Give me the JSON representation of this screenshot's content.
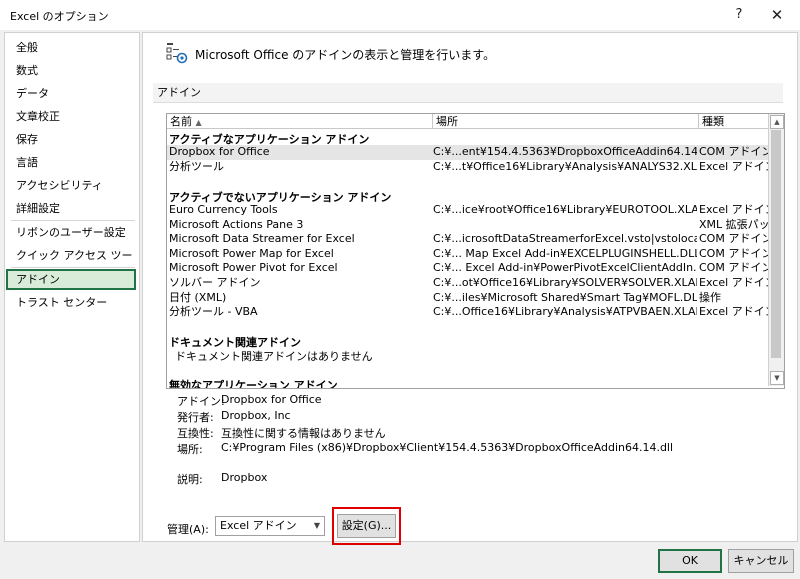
{
  "window": {
    "title": "Excel のオプション",
    "help": "?",
    "close": "✕"
  },
  "sidebar": {
    "items": [
      "全般",
      "数式",
      "データ",
      "文章校正",
      "保存",
      "言語",
      "アクセシビリティ",
      "詳細設定",
      "リボンのユーザー設定",
      "クイック アクセス ツール バー",
      "アドイン",
      "トラスト センター"
    ],
    "active": "アドイン"
  },
  "main": {
    "header": "Microsoft Office のアドインの表示と管理を行います。",
    "section": "アドイン",
    "columns": {
      "name": "名前",
      "sort": "▲",
      "location": "場所",
      "type": "種類"
    },
    "groups": {
      "active": "アクティブなアプリケーション アドイン",
      "inactive": "アクティブでないアプリケーション アドイン",
      "document": "ドキュメント関連アドイン",
      "document_empty": "ドキュメント関連アドインはありません",
      "disabled": "無効なアプリケーション アドイン"
    },
    "active_rows": [
      {
        "name": "Dropbox for Office",
        "location": "C:¥...ent¥154.4.5363¥DropboxOfficeAddin64.14.dll",
        "type": "COM アドイン"
      },
      {
        "name": "分析ツール",
        "location": "C:¥...t¥Office16¥Library¥Analysis¥ANALYS32.XLL",
        "type": "Excel アドイン"
      }
    ],
    "inactive_rows": [
      {
        "name": "Euro Currency Tools",
        "location": "C:¥...ice¥root¥Office16¥Library¥EUROTOOL.XLAM",
        "type": "Excel アドイン"
      },
      {
        "name": "Microsoft Actions Pane 3",
        "location": "",
        "type": "XML 拡張パック"
      },
      {
        "name": "Microsoft Data Streamer for Excel",
        "location": "C:¥...icrosoftDataStreamerforExcel.vsto|vstolocal",
        "type": "COM アドイン"
      },
      {
        "name": "Microsoft Power Map for Excel",
        "location": "C:¥... Map Excel Add-in¥EXCELPLUGINSHELL.DLL",
        "type": "COM アドイン"
      },
      {
        "name": "Microsoft Power Pivot for Excel",
        "location": "C:¥... Excel Add-in¥PowerPivotExcelClientAddIn.dll",
        "type": "COM アドイン"
      },
      {
        "name": "ソルバー アドイン",
        "location": "C:¥...ot¥Office16¥Library¥SOLVER¥SOLVER.XLAM",
        "type": "Excel アドイン"
      },
      {
        "name": "日付 (XML)",
        "location": "C:¥...iles¥Microsoft Shared¥Smart Tag¥MOFL.DLL",
        "type": "操作"
      },
      {
        "name": "分析ツール - VBA",
        "location": "C:¥...Office16¥Library¥Analysis¥ATPVBAEN.XLAM",
        "type": "Excel アドイン"
      }
    ],
    "details": [
      {
        "label": "アドイン:",
        "value": "Dropbox for Office"
      },
      {
        "label": "発行者:",
        "value": "Dropbox, Inc"
      },
      {
        "label": "互換性:",
        "value": "互換性に関する情報はありません"
      },
      {
        "label": "場所:",
        "value": "C:¥Program Files (x86)¥Dropbox¥Client¥154.4.5363¥DropboxOfficeAddin64.14.dll"
      },
      {
        "label": "説明:",
        "value": "Dropbox"
      }
    ],
    "manage_label": "管理(A):",
    "manage_value": "Excel アドイン",
    "go_button": "設定(G)..."
  },
  "footer": {
    "ok": "OK",
    "cancel": "キャンセル"
  },
  "colors": {
    "accent": "#217346",
    "highlight": "#e00000",
    "selected_row": "#e5e5e5"
  }
}
